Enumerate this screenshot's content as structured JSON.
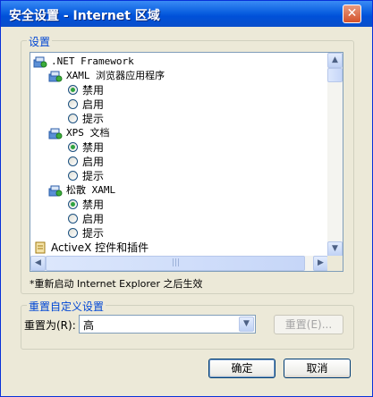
{
  "window": {
    "title": "安全设置 - Internet 区域",
    "close_glyph": "✕"
  },
  "settings": {
    "group_label": "设置",
    "items": [
      {
        "kind": "folder",
        "label": ".NET Framework"
      },
      {
        "kind": "folder",
        "label": "XAML 浏览器应用程序"
      },
      {
        "kind": "option",
        "label": "禁用",
        "checked": true
      },
      {
        "kind": "option",
        "label": "启用",
        "checked": false
      },
      {
        "kind": "option",
        "label": "提示",
        "checked": false
      },
      {
        "kind": "folder",
        "label": "XPS 文档"
      },
      {
        "kind": "option",
        "label": "禁用",
        "checked": true
      },
      {
        "kind": "option",
        "label": "启用",
        "checked": false
      },
      {
        "kind": "option",
        "label": "提示",
        "checked": false
      },
      {
        "kind": "folder",
        "label": "松散 XAML"
      },
      {
        "kind": "option",
        "label": "禁用",
        "checked": true
      },
      {
        "kind": "option",
        "label": "启用",
        "checked": false
      },
      {
        "kind": "option",
        "label": "提示",
        "checked": false
      },
      {
        "kind": "folder",
        "label": "ActiveX 控件和插件"
      }
    ],
    "note": "*重新启动 Internet Explorer 之后生效"
  },
  "reset": {
    "group_label": "重置自定义设置",
    "label": "重置为(R):",
    "selected": "高",
    "button": "重置(E)..."
  },
  "footer": {
    "ok": "确定",
    "cancel": "取消"
  },
  "colors": {
    "titlebar": "#0a5fe0",
    "group_label": "#0046d5",
    "radio_dot": "#2fa33f"
  }
}
